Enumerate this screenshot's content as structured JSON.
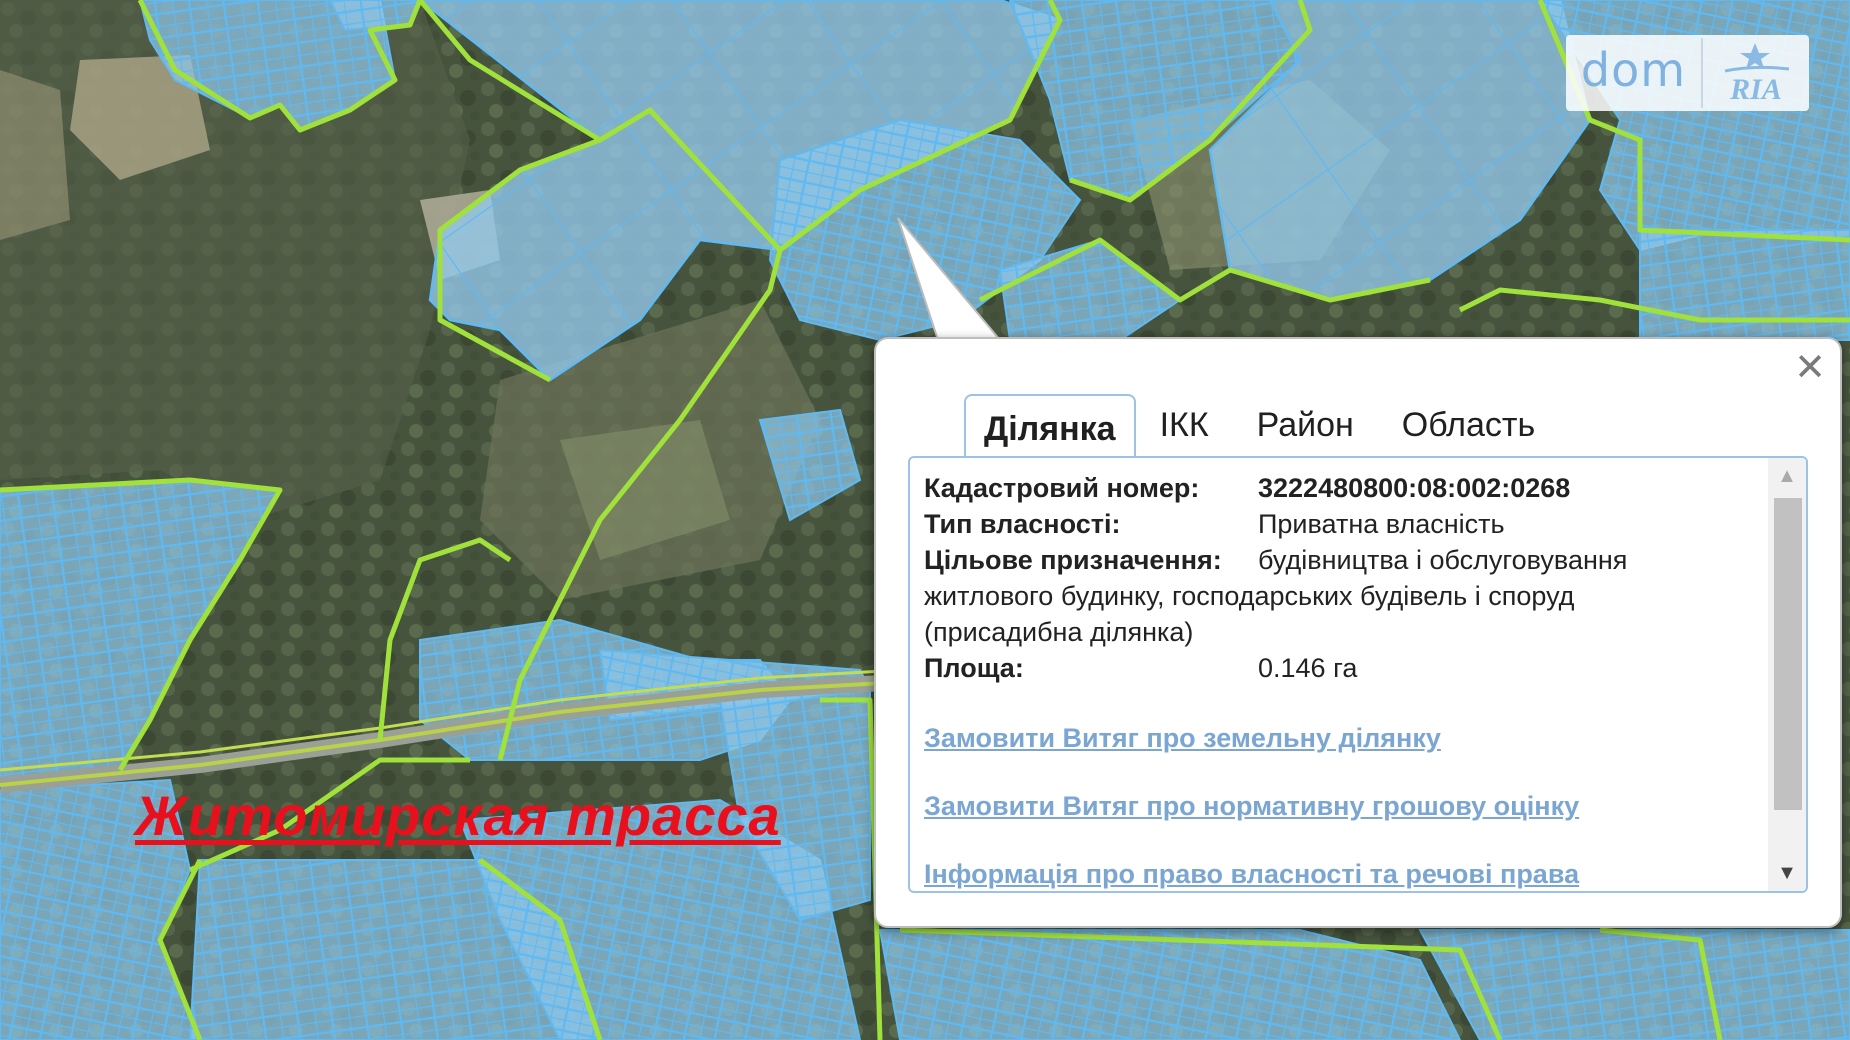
{
  "map": {
    "road_label": "Житомирская трасса"
  },
  "watermark": {
    "text_dom": "dom",
    "text_ria": "RIA"
  },
  "popup": {
    "close_symbol": "✕",
    "tabs": [
      "Ділянка",
      "ІКК",
      "Район",
      "Область"
    ],
    "active_tab": "Ділянка",
    "fields": {
      "cadastral_label": "Кадастровий номер:",
      "cadastral_value": "3222480800:08:002:0268",
      "ownership_label": "Тип власності:",
      "ownership_value": "Приватна власність",
      "purpose_label": "Цільове призначення:",
      "purpose_value_line1": "будівництва і обслуговування",
      "purpose_value_rest": "житлового будинку, господарських будівель і споруд (присадибна ділянка)",
      "area_label": "Площа:",
      "area_value": "0.146 га"
    },
    "links": [
      "Замовити Витяг про земельну ділянку",
      "Замовити Витяг про нормативну грошову оцінку",
      "Інформація про право власності та речові права"
    ],
    "scroll_up_symbol": "▲",
    "scroll_down_symbol": "▼"
  },
  "colors": {
    "parcel_fill": "#8ec8ee",
    "parcel_stroke": "#5ab8f0",
    "boundary_green": "#9ee03a",
    "road_label": "#e8101c",
    "link": "#7ba6d2"
  }
}
